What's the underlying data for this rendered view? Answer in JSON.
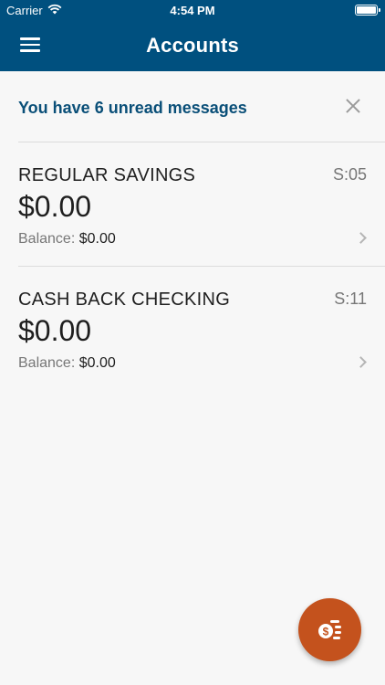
{
  "status_bar": {
    "carrier": "Carrier",
    "time": "4:54 PM"
  },
  "header": {
    "title": "Accounts"
  },
  "banner": {
    "message": "You have 6 unread messages"
  },
  "accounts": [
    {
      "name": "REGULAR SAVINGS",
      "code": "S:05",
      "amount": "$0.00",
      "balance_label": "Balance:",
      "balance_value": "$0.00"
    },
    {
      "name": "CASH BACK CHECKING",
      "code": "S:11",
      "amount": "$0.00",
      "balance_label": "Balance:",
      "balance_value": "$0.00"
    }
  ],
  "colors": {
    "header": "#00507f",
    "banner_text": "#0a4f78",
    "fab": "#c4521d"
  },
  "icons": {
    "menu": "hamburger-menu-icon",
    "close": "close-icon",
    "chevron": "chevron-right-icon",
    "fab": "transfer-money-icon"
  }
}
